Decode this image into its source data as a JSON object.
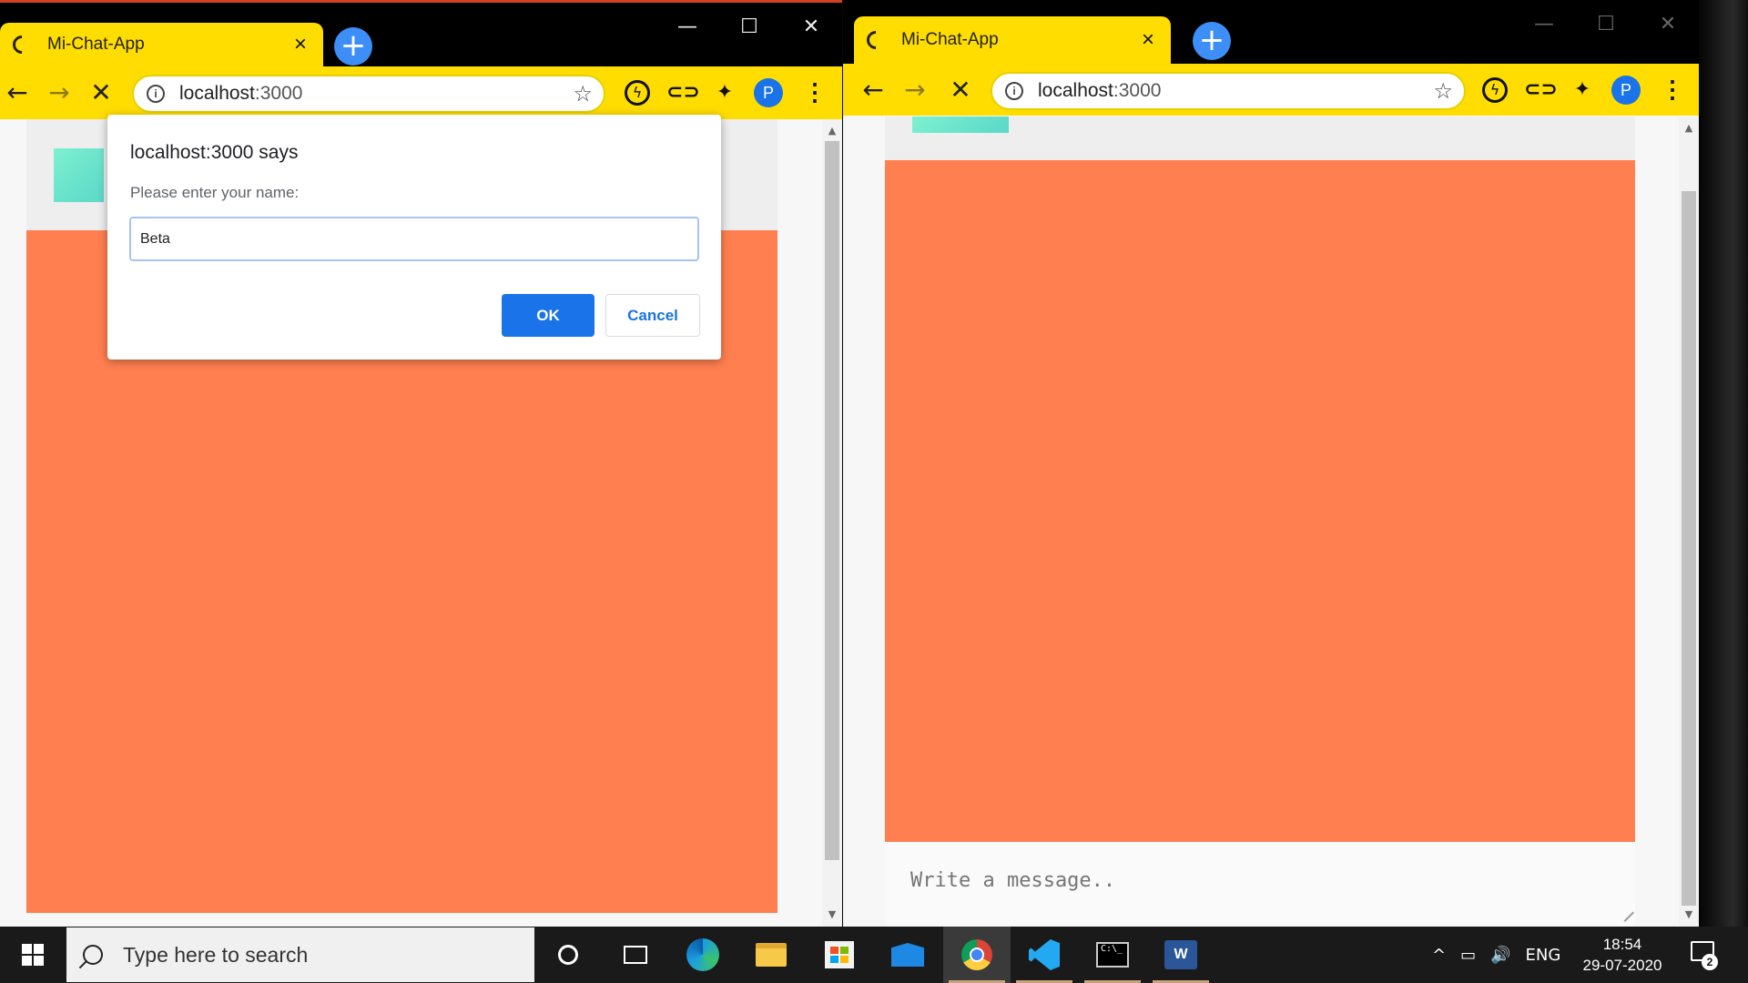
{
  "left_window": {
    "tab_title": "Mi-Chat-App",
    "tab_close": "×",
    "new_tab": "+",
    "window_controls": {
      "minimize": "—",
      "maximize": "☐",
      "close": "✕"
    },
    "nav": {
      "back": "←",
      "forward": "→",
      "stop": "✕"
    },
    "url_host": "localhost",
    "url_port": ":3000",
    "info": "i",
    "bookmark_star": "☆",
    "profile_initial": "P",
    "menu": "⋮",
    "extensions": {
      "bolt": "ϟ",
      "link": "⊂⊃",
      "puzzle": "✦"
    }
  },
  "dialog": {
    "title": "localhost:3000 says",
    "message": "Please enter your name:",
    "input_value": "Beta",
    "ok_label": "OK",
    "cancel_label": "Cancel"
  },
  "right_window": {
    "tab_title": "Mi-Chat-App",
    "tab_close": "×",
    "new_tab": "+",
    "window_controls": {
      "minimize": "—",
      "maximize": "☐",
      "close": "✕"
    },
    "nav": {
      "back": "←",
      "forward": "→",
      "stop": "✕"
    },
    "url_host": "localhost",
    "url_port": ":3000",
    "info": "i",
    "bookmark_star": "☆",
    "profile_initial": "P",
    "menu": "⋮",
    "extensions": {
      "bolt": "ϟ",
      "link": "⊂⊃",
      "puzzle": "✦"
    },
    "message_placeholder": "Write a message.."
  },
  "taskbar": {
    "search_placeholder": "Type here to search",
    "tray": {
      "chevron": "^",
      "battery": "▭",
      "volume": "🔊",
      "language": "ENG"
    },
    "time": "18:54",
    "date": "29-07-2020",
    "notification_count": "2",
    "terminal_prompt": "C:\\_"
  },
  "colors": {
    "tab_yellow": "#ffdd00",
    "chat_area": "#ff7f50",
    "primary_blue": "#1a73e8",
    "logo_teal": "#7ef0d0"
  }
}
